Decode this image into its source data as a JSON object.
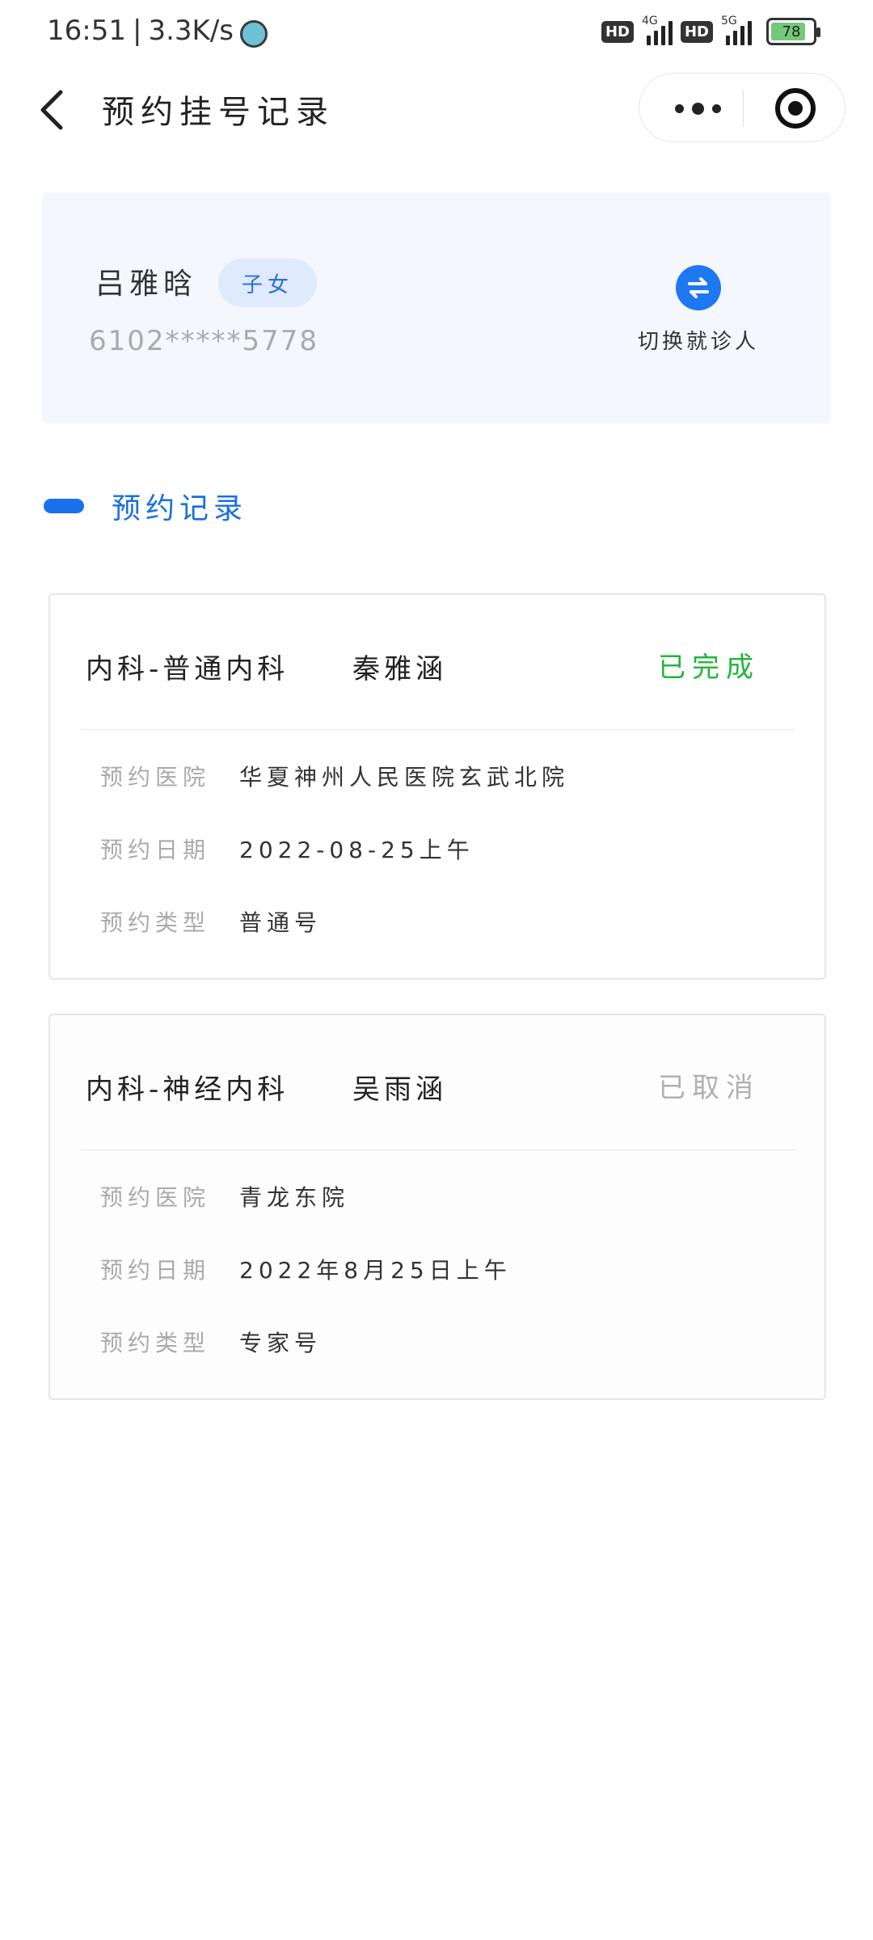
{
  "status_bar": {
    "time": "16:51",
    "speed": "3.3K/s",
    "hd1": "HD",
    "net1": "4G",
    "hd2": "HD",
    "net2": "5G",
    "battery": "78"
  },
  "nav": {
    "title": "预约挂号记录"
  },
  "patient": {
    "name": "吕雅晗",
    "relation": "子女",
    "id_masked": "6102*****5778",
    "switch_label": "切换就诊人"
  },
  "section": {
    "title": "预约记录"
  },
  "records": [
    {
      "dept": "内科-普通内科",
      "doctor": "秦雅涵",
      "status": "已完成",
      "status_color": "#21b63a",
      "fields": [
        {
          "label": "预约医院",
          "value": "华夏神州人民医院玄武北院"
        },
        {
          "label": "预约日期",
          "value": "2022-08-25上午"
        },
        {
          "label": "预约类型",
          "value": "普通号"
        }
      ]
    },
    {
      "dept": "内科-神经内科",
      "doctor": "吴雨涵",
      "status": "已取消",
      "status_color": "#b0b0b0",
      "fields": [
        {
          "label": "预约医院",
          "value": "青龙东院"
        },
        {
          "label": "预约日期",
          "value": "2022年8月25日上午"
        },
        {
          "label": "预约类型",
          "value": "专家号"
        }
      ]
    }
  ],
  "colors": {
    "accent": "#1870ef",
    "card_bg": "#f4f7fe"
  }
}
